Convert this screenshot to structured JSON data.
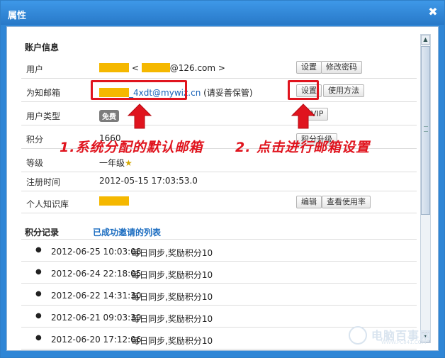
{
  "window": {
    "title": "属性",
    "close_icon": "close-icon"
  },
  "account": {
    "section_title": "账户信息",
    "rows": [
      {
        "label": "用户",
        "value_pre": "<",
        "value_post": "@126.com >"
      },
      {
        "label": "为知邮箱",
        "email": "_4xdt@mywiz.cn",
        "note": "(请妥善保管)"
      },
      {
        "label": "用户类型",
        "badge": "免费"
      },
      {
        "label": "积分",
        "value": "1660"
      },
      {
        "label": "等级",
        "value": "一年级"
      },
      {
        "label": "注册时间",
        "value": "2012-05-15 17:03:53.0"
      },
      {
        "label": "个人知识库"
      }
    ],
    "buttons": {
      "user_set": "设置",
      "change_password": "修改密码",
      "email_set": "设置",
      "usage": "使用方法",
      "vip": "VIP",
      "upgrade": "积分升级",
      "edit": "编辑",
      "view_usage": "查看使用率"
    }
  },
  "annotations": {
    "first": "1.系统分配的默认邮箱",
    "second": "2. 点击进行邮箱设置"
  },
  "history": {
    "tab_points": "积分记录",
    "tab_invites": "已成功邀请的列表",
    "entries": [
      {
        "time": "2012-06-25 10:03:08",
        "desc": "每日同步,奖励积分10"
      },
      {
        "time": "2012-06-24 22:18:05",
        "desc": "每日同步,奖励积分10"
      },
      {
        "time": "2012-06-22 14:31:30",
        "desc": "每日同步,奖励积分10"
      },
      {
        "time": "2012-06-21 09:03:39",
        "desc": "每日同步,奖励积分10"
      },
      {
        "time": "2012-06-20 17:12:06",
        "desc": "每日同步,奖励积分10"
      }
    ]
  },
  "watermark": {
    "text": "电脑百事网",
    "sub": "WWW.PC841.COM"
  },
  "colors": {
    "accent": "#2f86d6",
    "annotation_red": "#e0141e",
    "redaction": "#f5b800"
  }
}
